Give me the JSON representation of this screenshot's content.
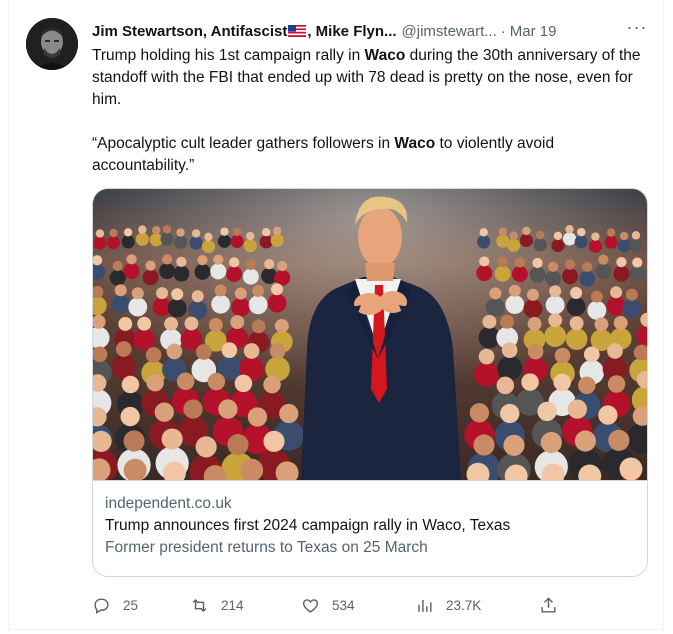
{
  "author": {
    "display_name": "Jim Stewartson, Antifascist",
    "flag_icon": "us-flag-icon",
    "display_name_tail": ", Mike Flyn...",
    "handle": "@jimstewart...",
    "separator": "·",
    "date": "Mar 19"
  },
  "more_label": "···",
  "tweet": {
    "p1_before": "Trump holding his 1st campaign rally in ",
    "p1_bold": "Waco",
    "p1_after": " during the 30th anniversary of the standoff with the FBI that ended up with 78 dead is pretty on the nose, even for him.",
    "p2_before": "“Apocalyptic cult leader gathers followers in ",
    "p2_bold": "Waco",
    "p2_after": " to violently avoid accountability.”"
  },
  "card": {
    "domain": "independent.co.uk",
    "title": "Trump announces first 2024 campaign rally in Waco, Texas",
    "description": "Former president returns to Texas on 25 March"
  },
  "actions": {
    "reply": {
      "icon": "reply-icon",
      "count": "25"
    },
    "retweet": {
      "icon": "retweet-icon",
      "count": "214"
    },
    "like": {
      "icon": "heart-icon",
      "count": "534"
    },
    "views": {
      "icon": "views-chart-icon",
      "count": "23.7K"
    },
    "share": {
      "icon": "share-icon"
    }
  },
  "colors": {
    "text": "#0f1419",
    "secondary": "#536471",
    "border": "#cfd9de",
    "tie_red": "#d4171f",
    "suit_navy": "#1b2540"
  }
}
